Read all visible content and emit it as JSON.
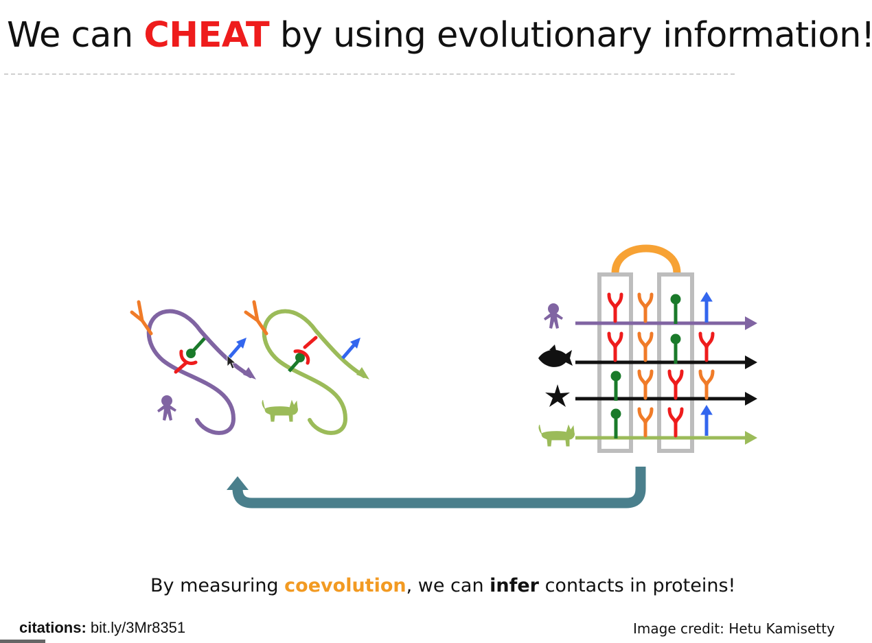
{
  "slide": {
    "title_pre": "We can ",
    "title_highlight": "CHEAT",
    "title_post": " by using evolutionary information!",
    "caption_pre": "By measuring ",
    "caption_coevolution": "coevolution",
    "caption_mid": ", we can ",
    "caption_infer": "infer",
    "caption_post": " contacts in proteins!",
    "citations_label": "citations:",
    "citations_link": " bit.ly/3Mr8351",
    "image_credit": "Image credit: Hetu Kamisetty"
  },
  "colors": {
    "title_highlight": "#ee1c1c",
    "coevolution": "#f29a22",
    "purple": "#8064a2",
    "green": "#9bbb59",
    "red": "#ee1c1c",
    "orange": "#f07b28",
    "dark_green": "#1a7a2a",
    "blue": "#3366ee",
    "gray_box": "#bdbdbd",
    "arc": "#f7a234",
    "teal_arrow": "#4a7f8c"
  },
  "icons": {
    "human": "human-icon",
    "fish": "fish-icon",
    "starfish": "starfish-icon",
    "cat": "cat-icon"
  }
}
